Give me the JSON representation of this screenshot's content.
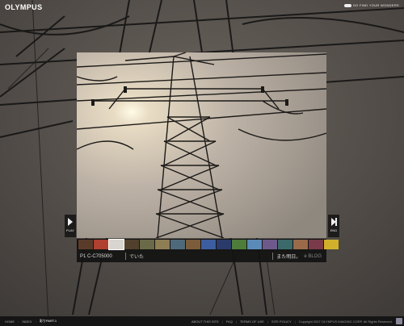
{
  "brand": {
    "logo": "OLYMPUS",
    "tagline": "GO FIND YOUR WONDERS"
  },
  "viewer": {
    "play_label": "PLAY",
    "end_label": "END",
    "caption": {
      "code": "P1 C-C705000",
      "text": "でいた",
      "right": "また明日。",
      "meta": "e BLOG"
    }
  },
  "thumbnails": [
    "#5a3b2a",
    "#b04030",
    "#d8d4cf",
    "#50402c",
    "#6b6a48",
    "#8e7e54",
    "#4e6a7a",
    "#7c5c3a",
    "#3c5ea0",
    "#2a3a6a",
    "#4e7c3a",
    "#5a8ab8",
    "#6e5a8a",
    "#3c6a6a",
    "#9a6a4a",
    "#7a3a4a",
    "#d0b02a"
  ],
  "footer": {
    "breadcrumb": [
      "HOME",
      "INDEX",
      "彩りPART.1"
    ],
    "links": [
      "ABOUT THIS SITE",
      "FAQ",
      "TERMS OF USE",
      "SITE POLICY"
    ],
    "copyright": "Copyright 2007 OLYMPUS IMAGING CORP. All Rights Reserved."
  }
}
